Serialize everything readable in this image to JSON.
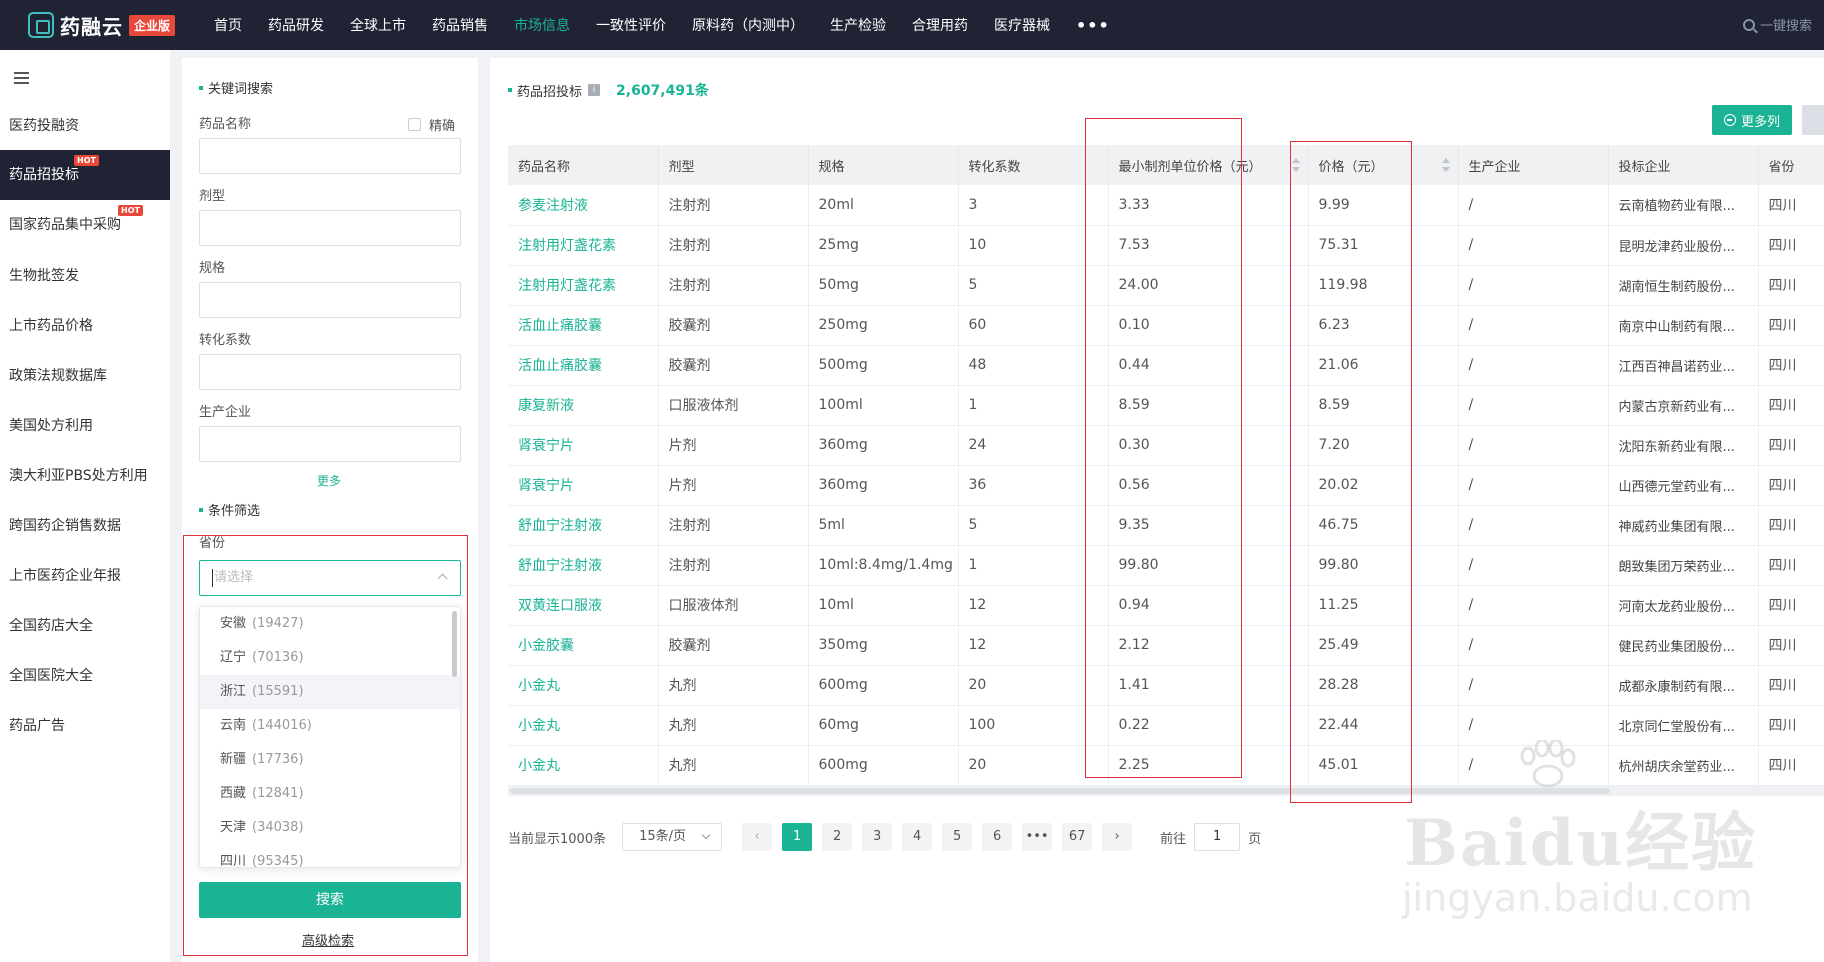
{
  "brand": {
    "name": "药融云",
    "edition": "企业版"
  },
  "nav": {
    "items": [
      "首页",
      "药品研发",
      "全球上市",
      "药品销售",
      "市场信息",
      "一致性评价",
      "原料药（内测中）",
      "生产检验",
      "合理用药",
      "医疗器械"
    ],
    "active_index": 4,
    "more": "•••",
    "search_label": "一键搜索"
  },
  "sidebar": {
    "items": [
      {
        "label": "医药投融资"
      },
      {
        "label": "药品招投标",
        "active": true,
        "hot": "HOT"
      },
      {
        "label": "国家药品集中采购",
        "hot": "HOT"
      },
      {
        "label": "生物批签发"
      },
      {
        "label": "上市药品价格"
      },
      {
        "label": "政策法规数据库"
      },
      {
        "label": "美国处方利用"
      },
      {
        "label": "澳大利亚PBS处方利用"
      },
      {
        "label": "跨国药企销售数据"
      },
      {
        "label": "上市医药企业年报"
      },
      {
        "label": "全国药店大全"
      },
      {
        "label": "全国医院大全"
      },
      {
        "label": "药品广告"
      }
    ]
  },
  "filter": {
    "keyword_title": "关键词搜索",
    "precise_label": "精确",
    "fields": [
      "药品名称",
      "剂型",
      "规格",
      "转化系数",
      "生产企业"
    ],
    "more_label": "更多",
    "condition_title": "条件筛选",
    "province_label": "省份",
    "province_placeholder": "请选择",
    "province_options": [
      {
        "name": "安徽",
        "count": "(19427)"
      },
      {
        "name": "辽宁",
        "count": "(70136)"
      },
      {
        "name": "浙江",
        "count": "(15591)",
        "hover": true
      },
      {
        "name": "云南",
        "count": "(144016)"
      },
      {
        "name": "新疆",
        "count": "(17736)"
      },
      {
        "name": "西藏",
        "count": "(12841)"
      },
      {
        "name": "天津",
        "count": "(34038)"
      },
      {
        "name": "四川",
        "count": "(95345)"
      }
    ],
    "search_button": "搜索",
    "advanced_link": "高级检索"
  },
  "main": {
    "title": "药品招投标",
    "info_icon": "i",
    "count": "2,607,491条",
    "more_columns_button": "更多列"
  },
  "table": {
    "columns": [
      "药品名称",
      "剂型",
      "规格",
      "转化系数",
      "最小制剂单位价格（元）",
      "价格（元）",
      "生产企业",
      "投标企业",
      "省份"
    ],
    "rows": [
      [
        "参麦注射液",
        "注射剂",
        "20ml",
        "3",
        "3.33",
        "9.99",
        "/",
        "云南植物药业有限...",
        "四川"
      ],
      [
        "注射用灯盏花素",
        "注射剂",
        "25mg",
        "10",
        "7.53",
        "75.31",
        "/",
        "昆明龙津药业股份...",
        "四川"
      ],
      [
        "注射用灯盏花素",
        "注射剂",
        "50mg",
        "5",
        "24.00",
        "119.98",
        "/",
        "湖南恒生制药股份...",
        "四川"
      ],
      [
        "活血止痛胶囊",
        "胶囊剂",
        "250mg",
        "60",
        "0.10",
        "6.23",
        "/",
        "南京中山制药有限...",
        "四川"
      ],
      [
        "活血止痛胶囊",
        "胶囊剂",
        "500mg",
        "48",
        "0.44",
        "21.06",
        "/",
        "江西百神昌诺药业...",
        "四川"
      ],
      [
        "康复新液",
        "口服液体剂",
        "100ml",
        "1",
        "8.59",
        "8.59",
        "/",
        "内蒙古京新药业有...",
        "四川"
      ],
      [
        "肾衰宁片",
        "片剂",
        "360mg",
        "24",
        "0.30",
        "7.20",
        "/",
        "沈阳东新药业有限...",
        "四川"
      ],
      [
        "肾衰宁片",
        "片剂",
        "360mg",
        "36",
        "0.56",
        "20.02",
        "/",
        "山西德元堂药业有...",
        "四川"
      ],
      [
        "舒血宁注射液",
        "注射剂",
        "5ml",
        "5",
        "9.35",
        "46.75",
        "/",
        "神威药业集团有限...",
        "四川"
      ],
      [
        "舒血宁注射液",
        "注射剂",
        "10ml:8.4mg/1.4mg",
        "1",
        "99.80",
        "99.80",
        "/",
        "朗致集团万荣药业...",
        "四川"
      ],
      [
        "双黄连口服液",
        "口服液体剂",
        "10ml",
        "12",
        "0.94",
        "11.25",
        "/",
        "河南太龙药业股份...",
        "四川"
      ],
      [
        "小金胶囊",
        "胶囊剂",
        "350mg",
        "12",
        "2.12",
        "25.49",
        "/",
        "健民药业集团股份...",
        "四川"
      ],
      [
        "小金丸",
        "丸剂",
        "600mg",
        "20",
        "1.41",
        "28.28",
        "/",
        "成都永康制药有限...",
        "四川"
      ],
      [
        "小金丸",
        "丸剂",
        "60mg",
        "100",
        "0.22",
        "22.44",
        "/",
        "北京同仁堂股份有...",
        "四川"
      ],
      [
        "小金丸",
        "丸剂",
        "600mg",
        "20",
        "2.25",
        "45.01",
        "/",
        "杭州胡庆余堂药业...",
        "四川"
      ]
    ]
  },
  "pagination": {
    "display_total": "当前显示1000条",
    "page_size": "15条/页",
    "pages": [
      "1",
      "2",
      "3",
      "4",
      "5",
      "6",
      "•••",
      "67"
    ],
    "current": "1",
    "goto_prefix": "前往",
    "goto_value": "1",
    "goto_suffix": "页"
  },
  "watermark": {
    "brand": "Baidu经验",
    "url": "jingyan.baidu.com"
  },
  "colors": {
    "accent": "#1ab394",
    "topbar": "#1f2333",
    "highlight_box": "#e0323a",
    "hot": "#e8483a"
  }
}
